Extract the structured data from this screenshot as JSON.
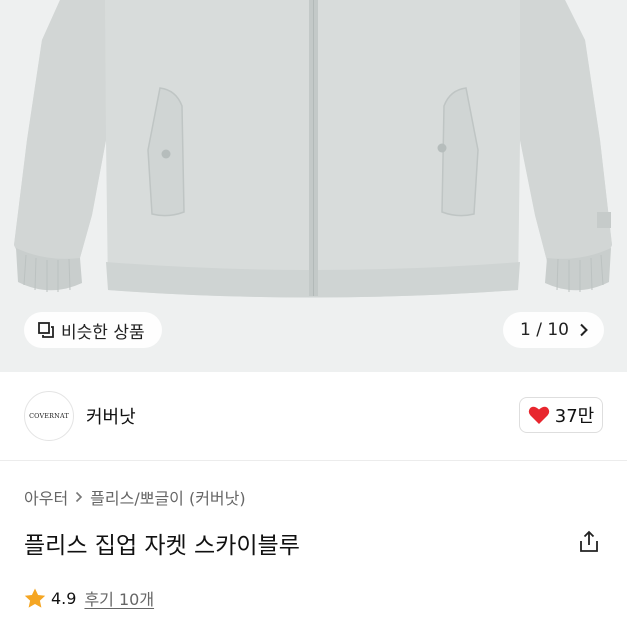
{
  "gallery": {
    "similar_label": "비슷한 상품",
    "counter": "1 / 10"
  },
  "brand": {
    "logo_text": "COVERNAT",
    "name": "커버낫",
    "likes": "37만"
  },
  "breadcrumb": {
    "items": [
      "아우터",
      "플리스/뽀글이 (커버낫)"
    ]
  },
  "product": {
    "title": "플리스 집업 자켓 스카이블루",
    "rating": "4.9",
    "reviews": "후기 10개"
  },
  "colors": {
    "heart": "#e8262e",
    "star": "#f5a623",
    "jacket": "#d8dcdb"
  },
  "icons": {
    "similar": "copy-icon",
    "next": "chevron-right-icon",
    "like": "heart-icon",
    "share": "share-icon",
    "rating": "star-icon"
  }
}
